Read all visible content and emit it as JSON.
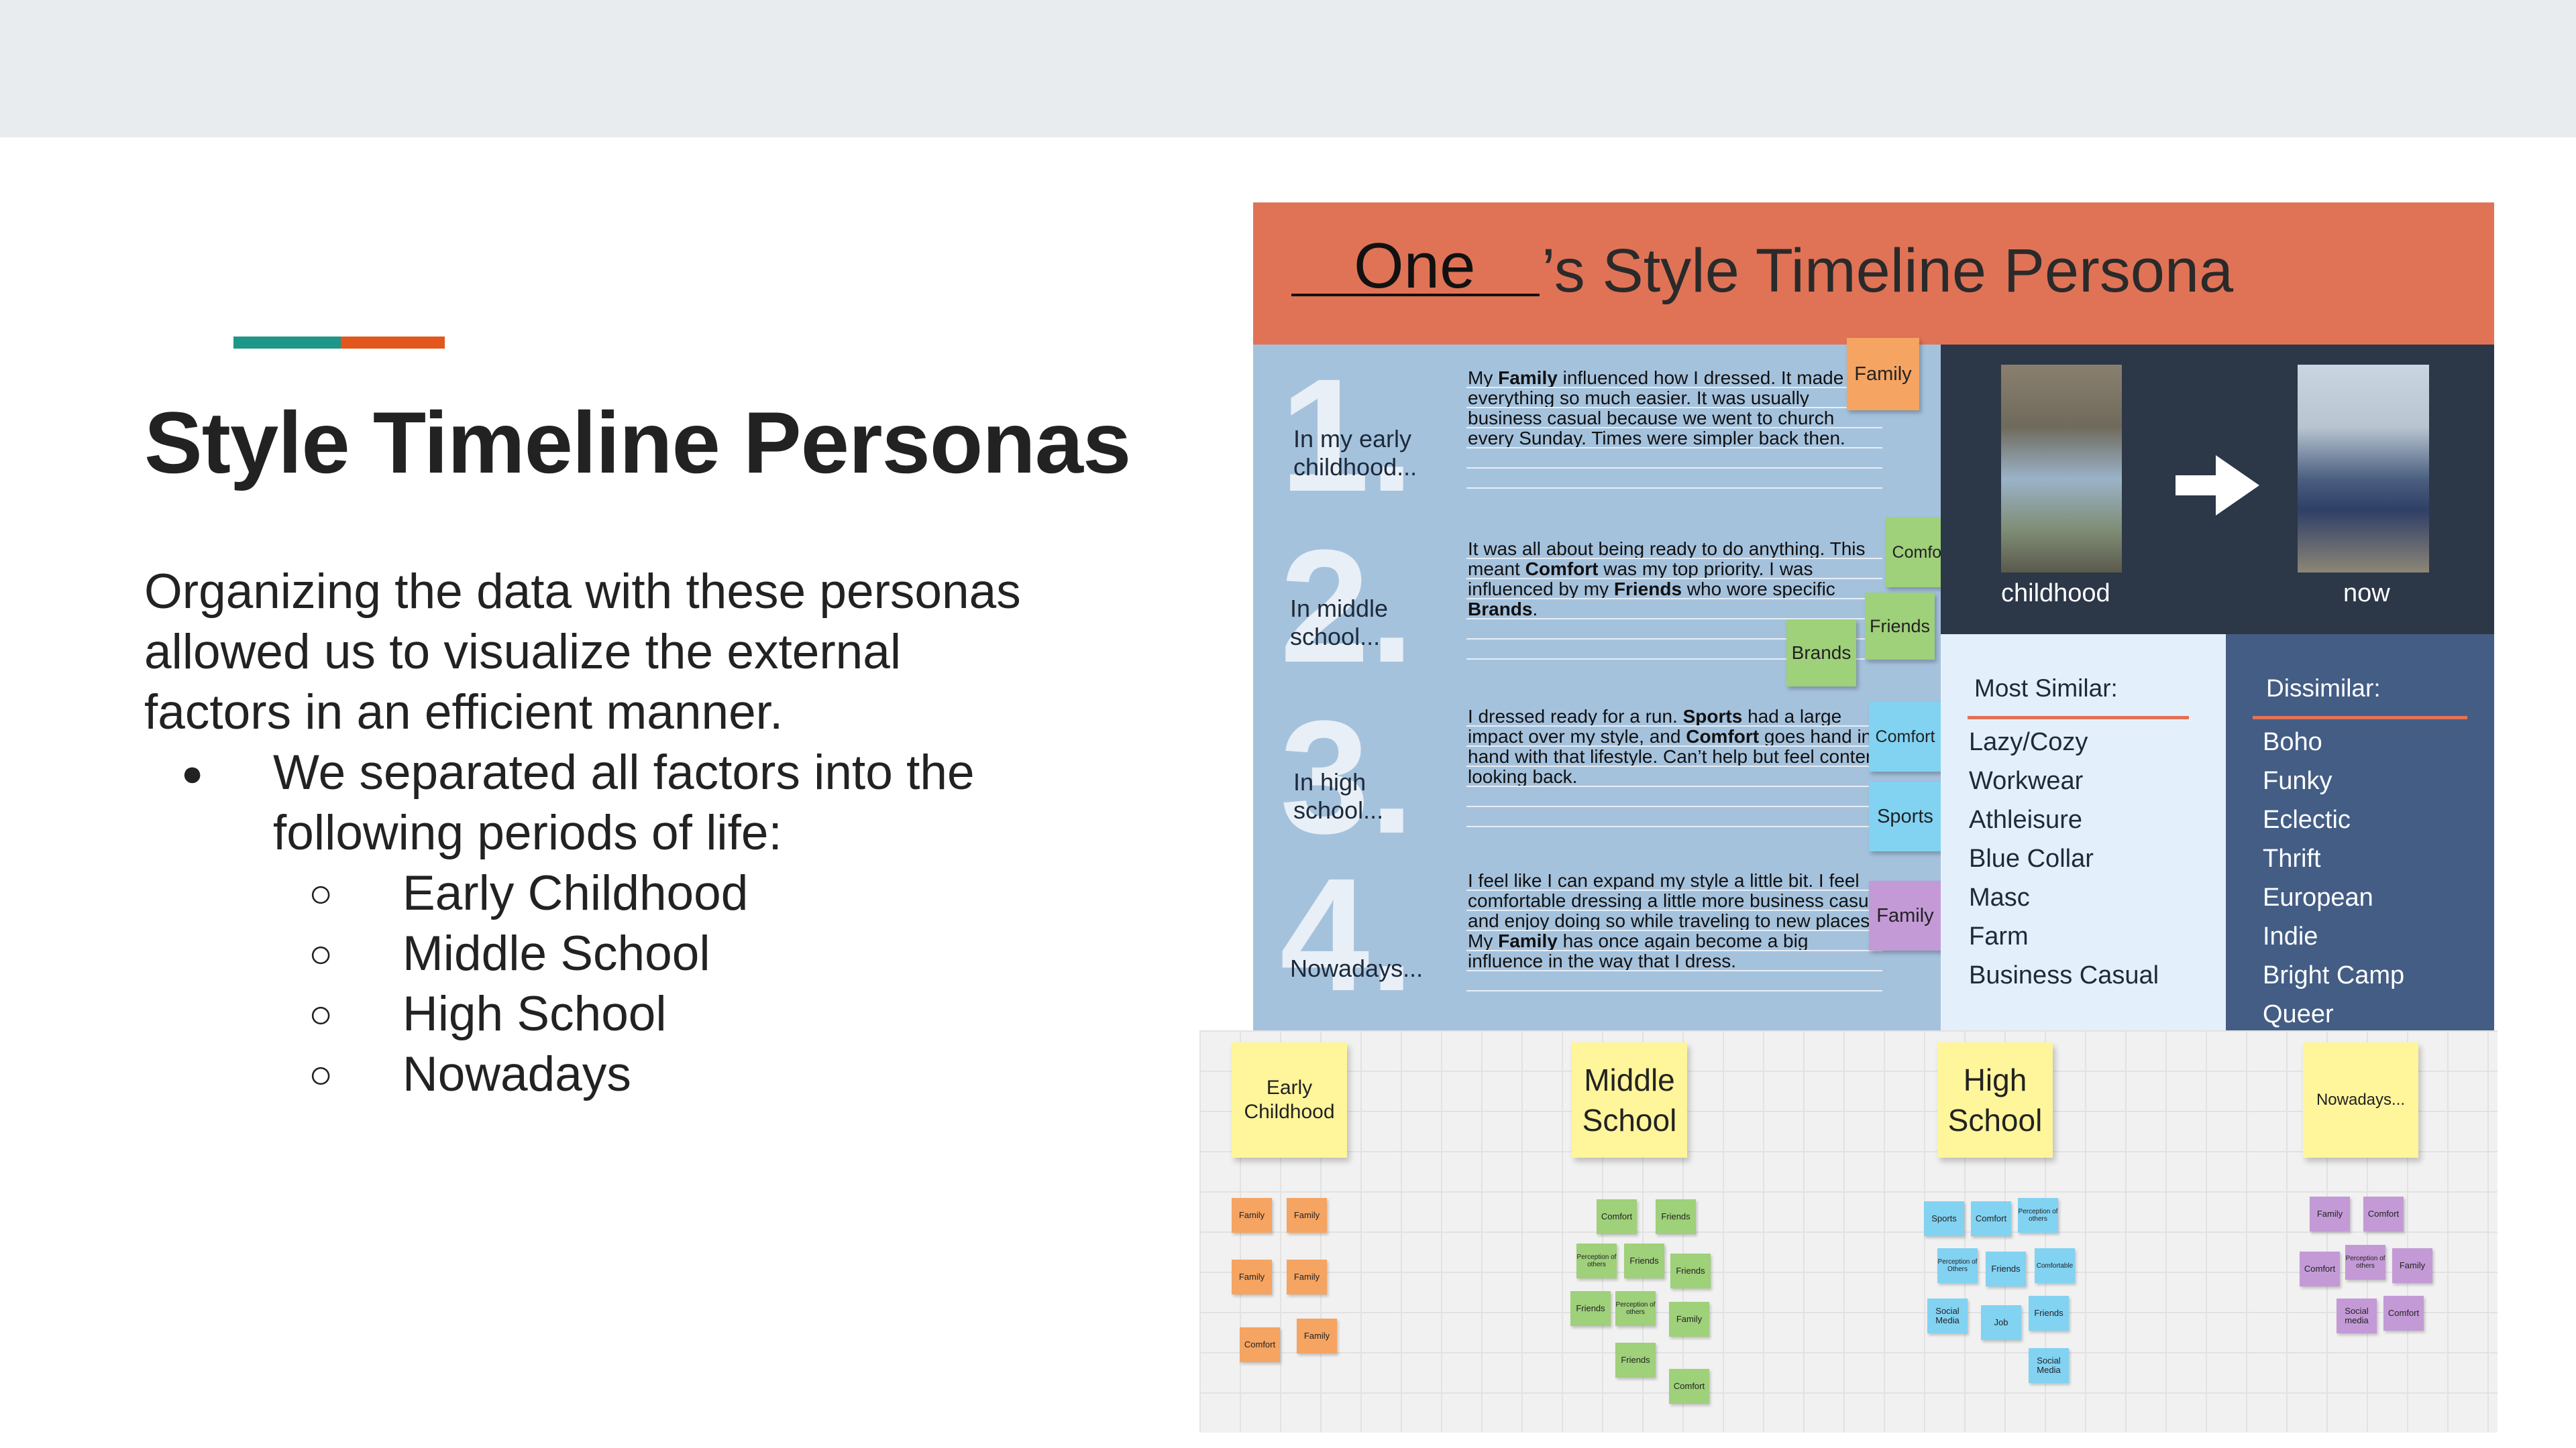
{
  "slide": {
    "title": "Style Timeline Personas",
    "paragraph_lines": [
      "Organizing the data with these personas",
      "allowed us to visualize the external",
      "factors in an efficient manner."
    ],
    "bullet_marker": "●",
    "bullet_lines": [
      "We separated all factors into the",
      "following periods of life:"
    ],
    "sub_marker": "○",
    "periods": [
      "Early Childhood",
      "Middle School",
      "High School",
      "Nowadays"
    ],
    "accent_colors": [
      "#1e9688",
      "#e2571d"
    ]
  },
  "persona": {
    "name": "One",
    "title": "’s Style Timeline Persona",
    "sections": [
      {
        "number": "1.",
        "period": [
          "In my early",
          "childhood..."
        ],
        "text_html": "My <b>Family</b> influenced how I dressed. It made everything so much easier. It was usually business casual because we went to church every Sunday. Times were simpler back then."
      },
      {
        "number": "2.",
        "period": [
          "In middle",
          "school..."
        ],
        "text_html": "It was all about being ready to do anything. This meant <b>Comfort</b> was my top priority. I was influenced by my <b>Friends</b> who wore specific <b>Brands</b>."
      },
      {
        "number": "3.",
        "period": [
          "In high",
          "school..."
        ],
        "text_html": "I dressed ready for a run. <b>Sports</b> had a large impact over my style, and <b>Comfort</b> goes hand in hand with that lifestyle. Can’t help but feel content looking back."
      },
      {
        "number": "4.",
        "period": [
          "Nowadays..."
        ],
        "text_html": "I feel like I can expand my style a little bit. I feel comfortable dressing a little more business casual and enjoy doing so while traveling to new places. My <b>Family</b> has once again become a big influence in the way that I dress."
      }
    ],
    "tags": {
      "family1": "Family",
      "comfort2": "Comfort",
      "friends2": "Friends",
      "brands2": "Brands",
      "comfort3": "Comfort",
      "sports3": "Sports",
      "family4": "Family"
    },
    "photo_labels": {
      "childhood": "childhood",
      "now": "now"
    },
    "most_similar": {
      "heading": "Most Similar:",
      "items": [
        "Lazy/Cozy",
        "Workwear",
        "Athleisure",
        "Blue Collar",
        "Masc",
        "Farm",
        "Business Casual"
      ]
    },
    "dissimilar": {
      "heading": "Dissimilar:",
      "items": [
        "Boho",
        "Funky",
        "Eclectic",
        "Thrift",
        "European",
        "Indie",
        "Bright Camp",
        "Queer"
      ]
    }
  },
  "board": {
    "headers": [
      "Early\nChildhood",
      "Middle\nSchool",
      "High\nSchool",
      "Nowadays..."
    ],
    "notes": {
      "early": [
        "Family",
        "Family",
        "Family",
        "Family",
        "Comfort",
        "Family"
      ],
      "middle": [
        "Comfort",
        "Friends",
        "Perception of others",
        "Friends",
        "Friends",
        "Friends",
        "Perception of others",
        "Family",
        "Friends",
        "Comfort"
      ],
      "high": [
        "Sports",
        "Comfort",
        "Perception of others",
        "Perception of Others",
        "Friends",
        "Comfortable",
        "Social Media",
        "Job",
        "Friends",
        "Social Media"
      ],
      "now": [
        "Family",
        "Comfort",
        "Comfort",
        "Perception of others",
        "Family",
        "Social media",
        "Comfort"
      ]
    }
  }
}
